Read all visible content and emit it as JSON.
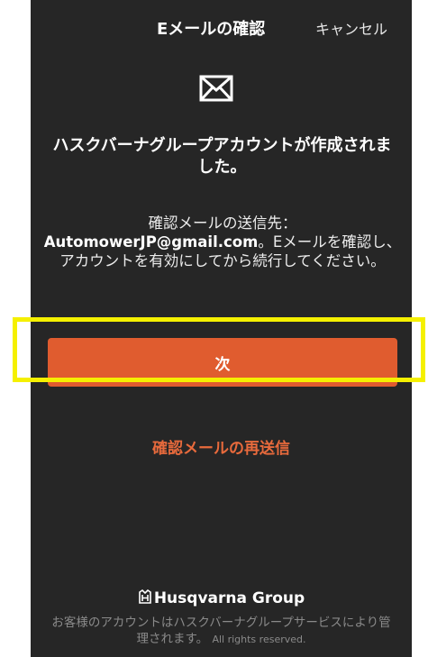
{
  "header": {
    "title": "Eメールの確認",
    "cancel_label": "キャンセル"
  },
  "icons": {
    "mail": "envelope-icon",
    "brand": "husqvarna-crown-icon"
  },
  "message": {
    "headline": "ハスクバーナグループアカウントが作成されました。",
    "body_prefix": "確認メールの送信先：",
    "email": "AutomowerJP@gmail.com",
    "body_suffix": "。Eメールを確認し、アカウントを有効にしてから続行してください。"
  },
  "actions": {
    "next_label": "次",
    "resend_label": "確認メールの再送信"
  },
  "footer": {
    "brand_name": "Husqvarna Group",
    "managed_text": "お客様のアカウントはハスクバーナグループサービスにより管理されます。",
    "rights_text": "All rights reserved."
  },
  "colors": {
    "background": "#262626",
    "accent": "#e05c2f",
    "resend_text": "#e86a3c",
    "highlight_box": "#f5f000"
  }
}
